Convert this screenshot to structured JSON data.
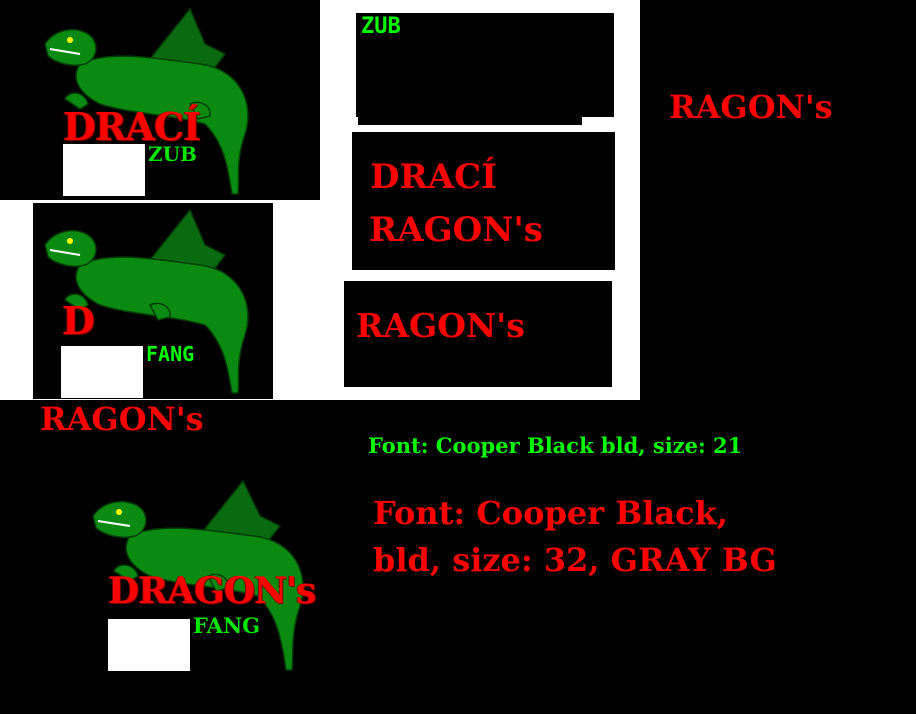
{
  "colors": {
    "background": "#000000",
    "white": "#ffffff",
    "red": "#ff0000",
    "green": "#00e600",
    "dragon_green": "#0b8a12"
  },
  "panel_1": {
    "word_main": "DRACÍ",
    "word_sub": "ZUB",
    "icon": "dragon-icon"
  },
  "panel_2": {
    "word_main": "D",
    "word_sub": "FANG",
    "icon": "dragon-icon"
  },
  "box_zub": {
    "text": "ZUB"
  },
  "box_draci": {
    "line1": "DRACÍ",
    "line2": "RAGON's"
  },
  "box_ragon": {
    "text": "RAGON's"
  },
  "right_ragon": {
    "text": "RAGON's"
  },
  "left_ragon": {
    "text": "RAGON's"
  },
  "font_note_small": {
    "text": "Font: Cooper Black bld, size: 21"
  },
  "font_note_large": {
    "line1": "Font: Cooper Black,",
    "line2": "bld, size: 32, GRAY BG"
  },
  "logo_large": {
    "word_main": "DRAGON's",
    "word_sub": "FANG",
    "icon": "dragon-icon"
  }
}
